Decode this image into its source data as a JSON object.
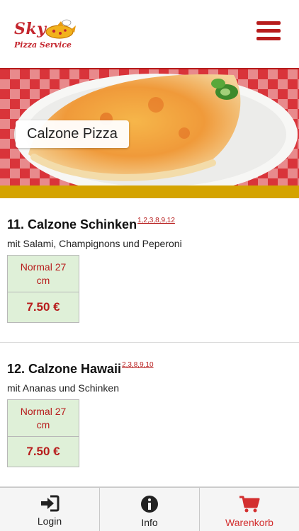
{
  "header": {
    "logo_top": "Sky",
    "logo_bottom": "Pizza Service",
    "menu_icon": "hamburger-menu-icon"
  },
  "hero": {
    "category_title": "Calzone Pizza"
  },
  "items": [
    {
      "title": "11. Calzone Schinken",
      "footnotes": "1,2,3,8,9,12",
      "description": "mit Salami, Champignons und Peperoni",
      "size": "Normal 27 cm",
      "price": "7.50 €"
    },
    {
      "title": "12. Calzone Hawaii",
      "footnotes": "2,3,8,9,10",
      "description": "mit Ananas und Schinken",
      "size": "Normal 27 cm",
      "price": "7.50 €"
    }
  ],
  "tabbar": {
    "login_label": "Login",
    "info_label": "Info",
    "cart_label": "Warenkorb",
    "icons": {
      "login": "login-icon",
      "info": "info-icon",
      "cart": "cart-icon"
    },
    "cart_color": "#d32f2f"
  },
  "colors": {
    "brand_red": "#b71c1c",
    "gold": "#d4a300",
    "price_bg": "#dff0d8"
  }
}
